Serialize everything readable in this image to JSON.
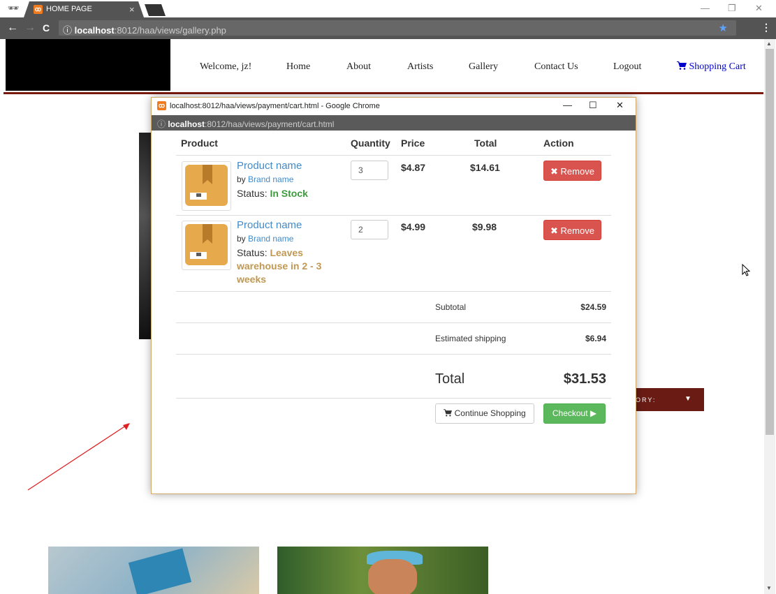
{
  "browser": {
    "tab_title": "HOME PAGE",
    "tab_close": "×",
    "url_host": "localhost",
    "url_rest": ":8012/haa/views/gallery.php",
    "back": "←",
    "forward": "→",
    "reload": "C",
    "info": "ⓘ",
    "star": "★",
    "menu": "⋮",
    "minimize": "—",
    "restore": "❐",
    "close": "✕"
  },
  "site_nav": {
    "welcome": "Welcome, jz!",
    "home": "Home",
    "about": "About",
    "artists": "Artists",
    "gallery": "Gallery",
    "contact": "Contact Us",
    "logout": "Logout",
    "cart": "Shopping Cart"
  },
  "category_bar": {
    "label": "ORY:",
    "caret": "▼"
  },
  "popup": {
    "window_title": "localhost:8012/haa/views/payment/cart.html - Google Chrome",
    "url_host": "localhost",
    "url_rest": ":8012/haa/views/payment/cart.html",
    "minimize": "—",
    "maximize": "☐",
    "close": "✕"
  },
  "cart": {
    "headers": {
      "product": "Product",
      "quantity": "Quantity",
      "price": "Price",
      "total": "Total",
      "action": "Action"
    },
    "items": [
      {
        "name": "Product name",
        "by": "by ",
        "brand": "Brand name",
        "status_label": "Status: ",
        "status": "In Stock",
        "quantity": "3",
        "price": "$4.87",
        "total": "$14.61",
        "remove": "✖ Remove"
      },
      {
        "name": "Product name",
        "by": "by ",
        "brand": "Brand name",
        "status_label": "Status: ",
        "status": "Leaves warehouse in 2 - 3 weeks",
        "quantity": "2",
        "price": "$4.99",
        "total": "$9.98",
        "remove": "✖ Remove"
      }
    ],
    "subtotal_label": "Subtotal",
    "subtotal": "$24.59",
    "shipping_label": "Estimated shipping",
    "shipping": "$6.94",
    "total_label": "Total",
    "total": "$31.53",
    "continue_label": "Continue Shopping",
    "checkout_label": "Checkout ▶"
  },
  "colors": {
    "accent_red_line": "#7a1a0c",
    "remove_button": "#d9534f",
    "checkout_button": "#5cb85c",
    "link_blue": "#428bca"
  }
}
